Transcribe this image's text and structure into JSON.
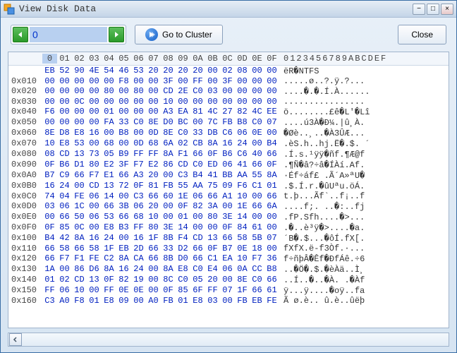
{
  "window": {
    "title": "View Disk Data"
  },
  "toolbar": {
    "cluster_input": "0",
    "goto_label": "Go to Cluster",
    "close_label": "Close"
  },
  "hex": {
    "col_headers": [
      "0",
      "01",
      "02",
      "03",
      "04",
      "05",
      "06",
      "07",
      "08",
      "09",
      "0A",
      "0B",
      "0C",
      "0D",
      "0E",
      "0F"
    ],
    "ascii_header": "0123456789ABCDEF",
    "rows": [
      {
        "off": "",
        "b": [
          "EB",
          "52",
          "90",
          "4E",
          "54",
          "46",
          "53",
          "20",
          "20",
          "20",
          "20",
          "00",
          "02",
          "08",
          "00",
          "00"
        ],
        "a": "ëR�NTFS"
      },
      {
        "off": "0x010",
        "b": [
          "00",
          "00",
          "00",
          "00",
          "00",
          "F8",
          "00",
          "00",
          "3F",
          "00",
          "FF",
          "00",
          "3F",
          "00",
          "00",
          "00"
        ],
        "a": ".....ø..?.ÿ.?..."
      },
      {
        "off": "0x020",
        "b": [
          "00",
          "00",
          "00",
          "00",
          "80",
          "00",
          "80",
          "00",
          "CD",
          "2E",
          "C0",
          "03",
          "00",
          "00",
          "00",
          "00"
        ],
        "a": "....�.�.Í.À......"
      },
      {
        "off": "0x030",
        "b": [
          "00",
          "00",
          "0C",
          "00",
          "00",
          "00",
          "00",
          "00",
          "10",
          "00",
          "00",
          "00",
          "00",
          "00",
          "00",
          "00"
        ],
        "a": "................"
      },
      {
        "off": "0x040",
        "b": [
          "F6",
          "00",
          "00",
          "00",
          "01",
          "00",
          "00",
          "00",
          "A3",
          "EA",
          "81",
          "4C",
          "27",
          "82",
          "4C",
          "EE"
        ],
        "a": "ö........£ê�L'�Lî"
      },
      {
        "off": "0x050",
        "b": [
          "00",
          "00",
          "00",
          "00",
          "FA",
          "33",
          "C0",
          "8E",
          "D0",
          "BC",
          "00",
          "7C",
          "FB",
          "B8",
          "C0",
          "07"
        ],
        "a": "....ú3À�Ð¼.|û¸À."
      },
      {
        "off": "0x060",
        "b": [
          "8E",
          "D8",
          "E8",
          "16",
          "00",
          "B8",
          "00",
          "0D",
          "8E",
          "C0",
          "33",
          "DB",
          "C6",
          "06",
          "0E",
          "00"
        ],
        "a": "�Øè..¸..�À3ÛÆ..."
      },
      {
        "off": "0x070",
        "b": [
          "10",
          "E8",
          "53",
          "00",
          "68",
          "00",
          "0D",
          "68",
          "6A",
          "02",
          "CB",
          "8A",
          "16",
          "24",
          "00",
          "B4"
        ],
        "a": ".èS.h..hj.Ë�.$. ´"
      },
      {
        "off": "0x080",
        "b": [
          "08",
          "CD",
          "13",
          "73",
          "05",
          "B9",
          "FF",
          "FF",
          "8A",
          "F1",
          "66",
          "0F",
          "B6",
          "C6",
          "40",
          "66"
        ],
        "a": ".Í.s.¹ÿÿ�ñf.¶Æ@f"
      },
      {
        "off": "0x090",
        "b": [
          "0F",
          "B6",
          "D1",
          "80",
          "E2",
          "3F",
          "F7",
          "E2",
          "86",
          "CD",
          "C0",
          "ED",
          "06",
          "41",
          "66",
          "0F"
        ],
        "a": ".¶Ñ�â?÷â�ÍÀí.Af."
      },
      {
        "off": "0x0A0",
        "b": [
          "B7",
          "C9",
          "66",
          "F7",
          "E1",
          "66",
          "A3",
          "20",
          "00",
          "C3",
          "B4",
          "41",
          "BB",
          "AA",
          "55",
          "8A"
        ],
        "a": "·Éf÷áf£ .Ã´A»ªU�"
      },
      {
        "off": "0x0B0",
        "b": [
          "16",
          "24",
          "00",
          "CD",
          "13",
          "72",
          "0F",
          "81",
          "FB",
          "55",
          "AA",
          "75",
          "09",
          "F6",
          "C1",
          "01"
        ],
        "a": ".$.Í.r.�ûUªu.öÁ."
      },
      {
        "off": "0x0C0",
        "b": [
          "74",
          "04",
          "FE",
          "06",
          "14",
          "00",
          "C3",
          "66",
          "60",
          "1E",
          "06",
          "66",
          "A1",
          "10",
          "00",
          "66"
        ],
        "a": "t.þ...Ãf`..f¡..f"
      },
      {
        "off": "0x0D0",
        "b": [
          "03",
          "06",
          "1C",
          "00",
          "66",
          "3B",
          "06",
          "20",
          "00",
          "0F",
          "82",
          "3A",
          "00",
          "1E",
          "66",
          "6A"
        ],
        "a": "....f;. ..�:..fj"
      },
      {
        "off": "0x0E0",
        "b": [
          "00",
          "66",
          "50",
          "06",
          "53",
          "66",
          "68",
          "10",
          "00",
          "01",
          "00",
          "80",
          "3E",
          "14",
          "00",
          "00"
        ],
        "a": ".fP.Sfh....�>..."
      },
      {
        "off": "0x0F0",
        "b": [
          "0F",
          "85",
          "0C",
          "00",
          "E8",
          "B3",
          "FF",
          "80",
          "3E",
          "14",
          "00",
          "00",
          "0F",
          "84",
          "61",
          "00"
        ],
        "a": ".�..è³ÿ�>....�a."
      },
      {
        "off": "0x100",
        "b": [
          "B4",
          "42",
          "8A",
          "16",
          "24",
          "00",
          "16",
          "1F",
          "8B",
          "F4",
          "CD",
          "13",
          "66",
          "58",
          "5B",
          "07"
        ],
        "a": "´B�.$...�ôÍ.fX[."
      },
      {
        "off": "0x110",
        "b": [
          "66",
          "58",
          "66",
          "58",
          "1F",
          "EB",
          "2D",
          "66",
          "33",
          "D2",
          "66",
          "0F",
          "B7",
          "0E",
          "18",
          "00"
        ],
        "a": "fXfX.ë-f3Òf.·..."
      },
      {
        "off": "0x120",
        "b": [
          "66",
          "F7",
          "F1",
          "FE",
          "C2",
          "8A",
          "CA",
          "66",
          "8B",
          "D0",
          "66",
          "C1",
          "EA",
          "10",
          "F7",
          "36"
        ],
        "a": "f÷ñþÂ�Êf�ÐfÁê.÷6"
      },
      {
        "off": "0x130",
        "b": [
          "1A",
          "00",
          "86",
          "D6",
          "8A",
          "16",
          "24",
          "00",
          "8A",
          "E8",
          "C0",
          "E4",
          "06",
          "0A",
          "CC",
          "B8"
        ],
        "a": "..�Ö�.$.�èÀä..Ì¸"
      },
      {
        "off": "0x140",
        "b": [
          "01",
          "02",
          "CD",
          "13",
          "0F",
          "82",
          "19",
          "00",
          "8C",
          "C0",
          "05",
          "20",
          "00",
          "8E",
          "C0",
          "66"
        ],
        "a": "..Í..�..�À. .�Àf"
      },
      {
        "off": "0x150",
        "b": [
          "FF",
          "06",
          "10",
          "00",
          "FF",
          "0E",
          "0E",
          "00",
          "0F",
          "85",
          "6F",
          "FF",
          "07",
          "1F",
          "66",
          "61"
        ],
        "a": "ÿ...ÿ....�oÿ..fa"
      },
      {
        "off": "0x160",
        "b": [
          "C3",
          "A0",
          "F8",
          "01",
          "E8",
          "09",
          "00",
          "A0",
          "FB",
          "01",
          "E8",
          "03",
          "00",
          "FB",
          "EB",
          "FE"
        ],
        "a": "Ã ø.è.. û.è..ûëþ"
      }
    ]
  }
}
